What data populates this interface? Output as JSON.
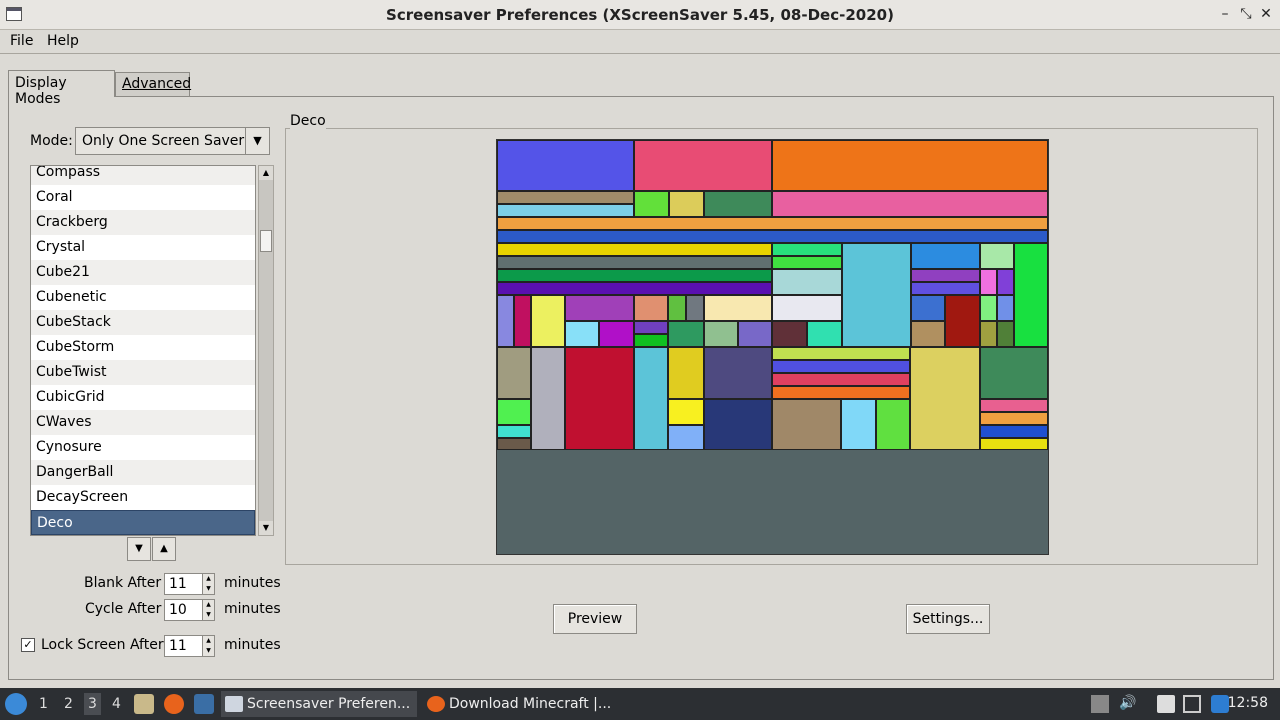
{
  "window": {
    "title": "Screensaver Preferences  (XScreenSaver 5.45, 08-Dec-2020)",
    "controls": [
      "–",
      "⤡",
      "✕"
    ]
  },
  "menubar": {
    "file": "File",
    "help": "Help"
  },
  "tabs": {
    "display_modes": "Display Modes",
    "advanced": "Advanced"
  },
  "mode": {
    "label": "Mode:",
    "value": "Only One Screen Saver"
  },
  "savers": [
    "Compass",
    "Coral",
    "Crackberg",
    "Crystal",
    "Cube21",
    "Cubenetic",
    "CubeStack",
    "CubeStorm",
    "CubeTwist",
    "CubicGrid",
    "CWaves",
    "Cynosure",
    "DangerBall",
    "DecayScreen",
    "Deco"
  ],
  "selected_saver": "Deco",
  "settings": {
    "blank_label": "Blank After",
    "blank_value": "11",
    "cycle_label": "Cycle After",
    "cycle_value": "10",
    "lock_label": "Lock Screen After",
    "lock_value": "11",
    "lock_checked": true,
    "unit": "minutes"
  },
  "preview": {
    "frame_label": "Deco",
    "preview_button": "Preview",
    "settings_button": "Settings..."
  },
  "taskbar": {
    "workspaces": [
      "1",
      "2",
      "3",
      "4"
    ],
    "active_workspace": "3",
    "task_screensaver": "Screensaver Preferen...",
    "task_browser": "Download Minecraft |...",
    "clock": "12:58"
  },
  "colors": {
    "selection": "#4a6689",
    "taskbar": "#2c2f33",
    "preview_background": "#546466"
  }
}
